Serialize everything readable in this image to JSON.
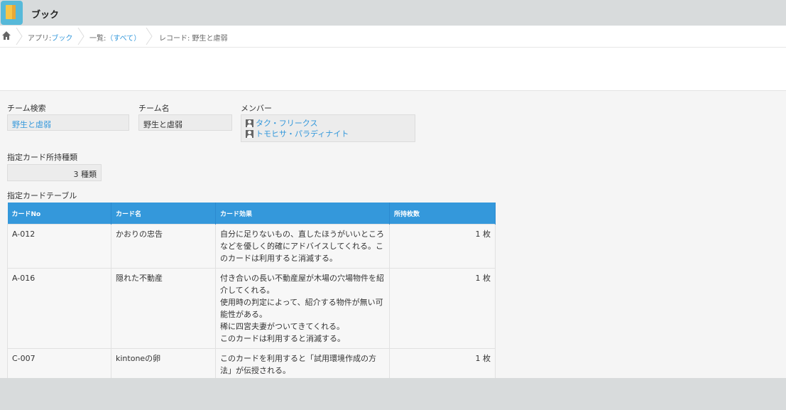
{
  "header": {
    "app_title": "ブック"
  },
  "breadcrumb": {
    "app_prefix": "アプリ:",
    "app_link": "ブック",
    "list_prefix": "一覧:",
    "list_link": "（すべて）",
    "record": "レコード: 野生と虐弱"
  },
  "fields": {
    "team_search": {
      "label": "チーム検索",
      "value": "野生と虐弱"
    },
    "team_name": {
      "label": "チーム名",
      "value": "野生と虐弱"
    },
    "members": {
      "label": "メンバー",
      "items": [
        "タク・フリークス",
        "トモヒサ・パラディナイト"
      ]
    },
    "card_kinds": {
      "label": "指定カード所持種類",
      "value": "3 種類"
    }
  },
  "table": {
    "title": "指定カードテーブル",
    "headers": [
      "カードNo",
      "カード名",
      "カード効果",
      "所持枚数"
    ],
    "rows": [
      {
        "no": "A-012",
        "name": "かおりの忠告",
        "effect": "自分に足りないもの、直したほうがいいところなどを優しく的確にアドバイスしてくれる。このカードは利用すると消滅する。",
        "qty": "1 枚"
      },
      {
        "no": "A-016",
        "name": "隠れた不動産",
        "effect": "付き合いの長い不動産屋が木場の穴場物件を紹介してくれる。\n使用時の判定によって、紹介する物件が無い可能性がある。\n稀に四宮夫妻がついてきてくれる。\nこのカードは利用すると消滅する。",
        "qty": "1 枚"
      },
      {
        "no": "C-007",
        "name": "kintoneの卵",
        "effect": "このカードを利用すると「試用環境作成の方法」が伝授される。",
        "qty": "1 枚"
      }
    ]
  }
}
